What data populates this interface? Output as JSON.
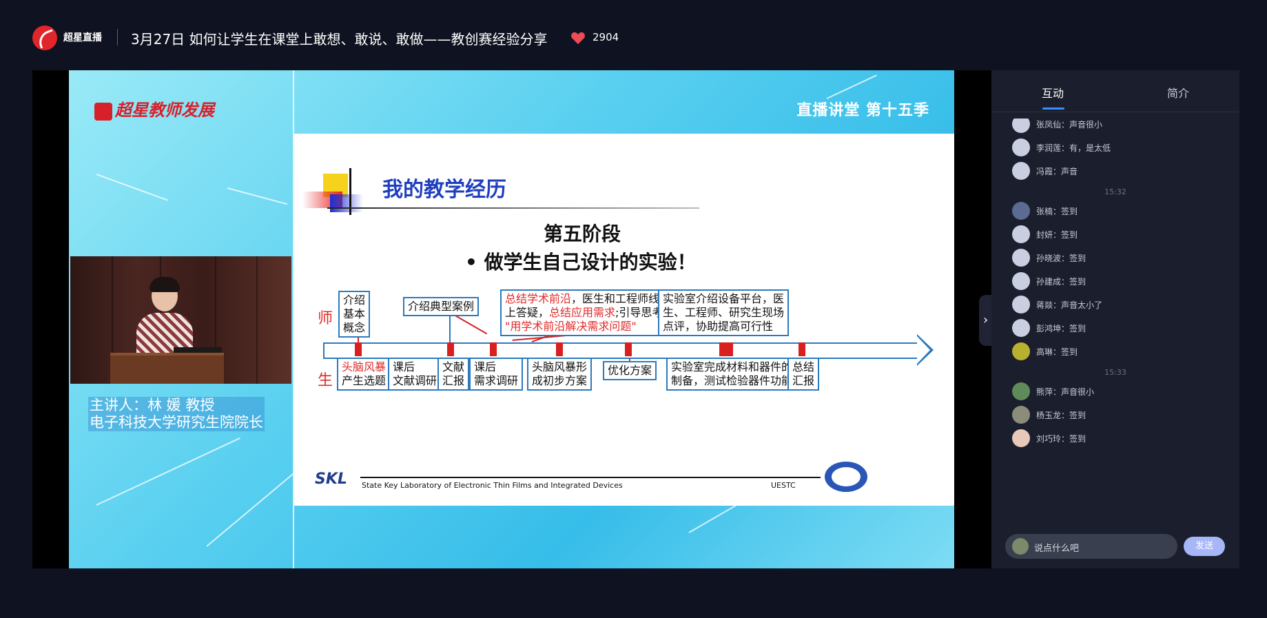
{
  "header": {
    "app_name": "超星直播",
    "title": "3月27日 如何让学生在课堂上敢想、敢说、敢做——教创赛经验分享",
    "likes": "2904"
  },
  "video": {
    "brand": "超星教师发展",
    "season": "直播讲堂  第十五季",
    "speaker_line1": "主讲人：林 媛 教授",
    "speaker_line2": "电子科技大学研究生院院长"
  },
  "slide": {
    "title": "我的教学经历",
    "stage": "第五阶段",
    "bullet": "•  做学生自己设计的实验！",
    "role_teacher": "师",
    "role_student": "生",
    "teacher_boxes": [
      {
        "lines": [
          "介绍",
          "基本",
          "概念"
        ]
      },
      {
        "lines": [
          "介绍典型案例"
        ]
      },
      {
        "a": "总结学术前沿",
        "b": "，医生和工程师线",
        "c": "上答疑，",
        "d": "总结应用需求",
        "e": ";引导思考",
        "f": "\"用学术前沿解决需求问题\""
      },
      {
        "lines": [
          "实验室介绍设备平台，医",
          "生、工程师、研究生现场",
          "点评，协助提高可行性"
        ]
      }
    ],
    "student_boxes": [
      {
        "red": "头脑风暴",
        "rest": "产生选题"
      },
      {
        "lines": [
          "课后",
          "文献调研"
        ]
      },
      {
        "lines": [
          "文献",
          "汇报"
        ]
      },
      {
        "lines": [
          "课后",
          "需求调研"
        ]
      },
      {
        "lines": [
          "头脑风暴形",
          "成初步方案"
        ]
      },
      {
        "lines": [
          "优化方案"
        ]
      },
      {
        "lines": [
          "实验室完成材料和器件的",
          "制备，测试检验器件功能"
        ]
      },
      {
        "lines": [
          "总结",
          "汇报"
        ]
      }
    ],
    "footer_logo": "SKL",
    "footer_text": "State Key Laboratory of Electronic Thin Films and Integrated Devices",
    "footer_uestc": "UESTC"
  },
  "panel": {
    "tabs": [
      "互动",
      "简介"
    ],
    "messages": [
      {
        "name": "张凤仙",
        "text": "声音很小"
      },
      {
        "name": "李润莲",
        "text": "有，是太低"
      },
      {
        "name": "冯霞",
        "text": "声音"
      },
      {
        "time": "15:32"
      },
      {
        "name": "张楠",
        "text": "签到"
      },
      {
        "name": "封妍",
        "text": "签到"
      },
      {
        "name": "孙晓波",
        "text": "签到"
      },
      {
        "name": "孙建成",
        "text": "签到"
      },
      {
        "name": "蒋燚",
        "text": "声音太小了"
      },
      {
        "name": "彭鸿坤",
        "text": "签到"
      },
      {
        "name": "高琳",
        "text": "签到"
      },
      {
        "time": "15:33"
      },
      {
        "name": "熊萍",
        "text": "声音很小"
      },
      {
        "name": "杨玉龙",
        "text": "签到"
      },
      {
        "name": "刘巧玲",
        "text": "签到"
      }
    ],
    "input_placeholder": "说点什么吧",
    "send_label": "发送"
  },
  "colors": {
    "page_bg": "#0f1220",
    "panel_bg": "#1b1f2d",
    "accent": "#3b8cff",
    "like_heart": "#ef4b55",
    "send_button": "#a6b6f7"
  }
}
